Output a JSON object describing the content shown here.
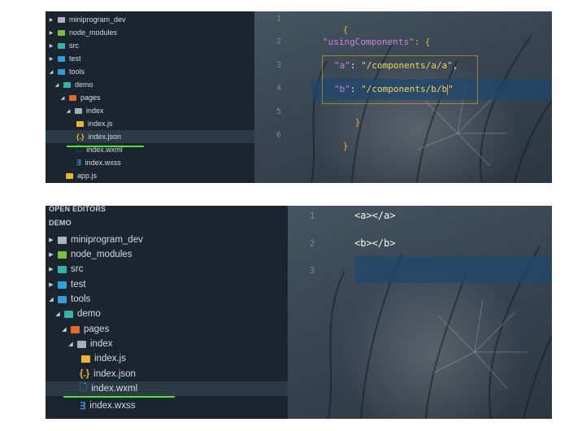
{
  "top": {
    "tree": [
      {
        "label": "miniprogram_dev",
        "icon": "folder-icon"
      },
      {
        "label": "node_modules",
        "icon": "folder-node-icon"
      },
      {
        "label": "src",
        "icon": "folder-src-icon"
      },
      {
        "label": "test",
        "icon": "folder-test-icon"
      },
      {
        "label": "tools",
        "icon": "folder-open-icon"
      },
      {
        "label": "demo",
        "icon": "folder-open-icon"
      },
      {
        "label": "pages",
        "icon": "folder-open-icon"
      },
      {
        "label": "index",
        "icon": "folder-open-icon"
      },
      {
        "label": "index.js",
        "icon": "js-file-icon"
      },
      {
        "label": "index.json",
        "icon": "json-file-icon"
      },
      {
        "label": "index.wxml",
        "icon": "wxml-file-icon"
      },
      {
        "label": "index.wxss",
        "icon": "wxss-file-icon"
      },
      {
        "label": "app.js",
        "icon": "js-file-icon"
      }
    ],
    "line_numbers": [
      "1",
      "2",
      "3",
      "4",
      "5",
      "6"
    ],
    "code": {
      "l1": "{",
      "l2_key": "\"usingComponents\"",
      "l2_rest": ": {",
      "l3_key": "\"a\"",
      "l3_colon": ": ",
      "l3_val": "\"/components/a/a\"",
      "l3_comma": ",",
      "l4_key": "\"b\"",
      "l4_colon": ": ",
      "l4_val_a": "\"/components/b/b",
      "l4_val_b": "\"",
      "l5": "}",
      "l6": "}"
    }
  },
  "bottom": {
    "open_editors_label": "OPEN EDITORS",
    "demo_label": "DEMO",
    "tree": [
      {
        "label": "miniprogram_dev"
      },
      {
        "label": "node_modules"
      },
      {
        "label": "src"
      },
      {
        "label": "test"
      },
      {
        "label": "tools"
      },
      {
        "label": "demo"
      },
      {
        "label": "pages"
      },
      {
        "label": "index"
      },
      {
        "label": "index.js"
      },
      {
        "label": "index.json"
      },
      {
        "label": "index.wxml"
      },
      {
        "label": "index.wxss"
      }
    ],
    "line_numbers": [
      "1",
      "2",
      "3"
    ],
    "code": {
      "l1": "<a></a>",
      "l2": "<b></b>"
    }
  },
  "colors": {
    "annotation_line": "#4ee52a",
    "sidebar_bg": "#1b2530",
    "cursor": "#ff8a2a"
  }
}
